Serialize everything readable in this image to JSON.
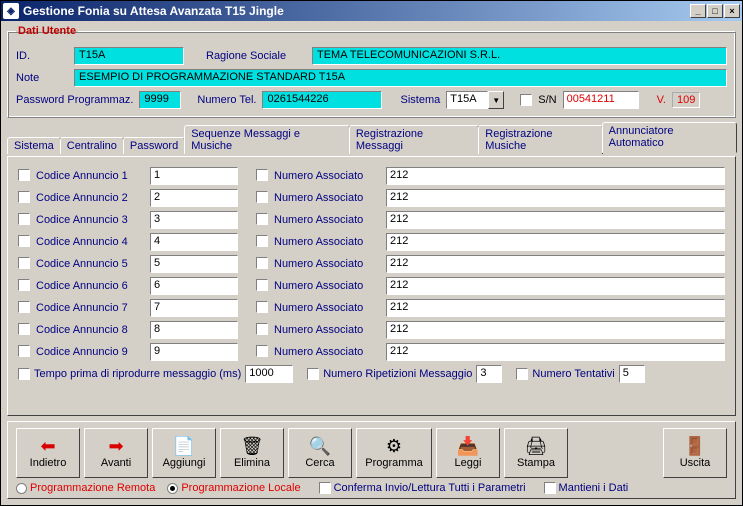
{
  "window": {
    "title": "Gestione Fonia su Attesa Avanzata T15 Jingle"
  },
  "dati": {
    "legend": "Dati Utente",
    "id_label": "ID.",
    "id_value": "T15A",
    "ragione_label": "Ragione Sociale",
    "ragione_value": "TEMA TELECOMUNICAZIONI S.R.L.",
    "note_label": "Note",
    "note_value": "ESEMPIO DI PROGRAMMAZIONE STANDARD T15A",
    "pw_label": "Password Programmaz.",
    "pw_value": "9999",
    "tel_label": "Numero Tel.",
    "tel_value": "0261544226",
    "sistema_label": "Sistema",
    "sistema_value": "T15A",
    "sn_label": "S/N",
    "sn_value": "00541211",
    "v_label": "V.",
    "v_value": "109"
  },
  "tabs": {
    "t1": "Sistema",
    "t2": "Centralino",
    "t3": "Password",
    "t4": "Sequenze Messaggi e Musiche",
    "t5": "Registrazione Messaggi",
    "t6": "Registrazione Musiche",
    "t7": "Annunciatore Automatico"
  },
  "ann": {
    "rows": [
      {
        "label": "Codice Annuncio 1",
        "code": "1",
        "assoc_label": "Numero Associato",
        "num": "212"
      },
      {
        "label": "Codice Annuncio 2",
        "code": "2",
        "assoc_label": "Numero Associato",
        "num": "212"
      },
      {
        "label": "Codice Annuncio 3",
        "code": "3",
        "assoc_label": "Numero Associato",
        "num": "212"
      },
      {
        "label": "Codice Annuncio 4",
        "code": "4",
        "assoc_label": "Numero Associato",
        "num": "212"
      },
      {
        "label": "Codice Annuncio 5",
        "code": "5",
        "assoc_label": "Numero Associato",
        "num": "212"
      },
      {
        "label": "Codice Annuncio 6",
        "code": "6",
        "assoc_label": "Numero Associato",
        "num": "212"
      },
      {
        "label": "Codice Annuncio 7",
        "code": "7",
        "assoc_label": "Numero Associato",
        "num": "212"
      },
      {
        "label": "Codice Annuncio 8",
        "code": "8",
        "assoc_label": "Numero Associato",
        "num": "212"
      },
      {
        "label": "Codice Annuncio 9",
        "code": "9",
        "assoc_label": "Numero Associato",
        "num": "212"
      }
    ],
    "tempo_label": "Tempo prima di riprodurre messaggio (ms)",
    "tempo_value": "1000",
    "rip_label": "Numero Ripetizioni Messaggio",
    "rip_value": "3",
    "tent_label": "Numero Tentativi",
    "tent_value": "5"
  },
  "toolbar": {
    "indietro": "Indietro",
    "avanti": "Avanti",
    "aggiungi": "Aggiungi",
    "elimina": "Elimina",
    "cerca": "Cerca",
    "programma": "Programma",
    "leggi": "Leggi",
    "stampa": "Stampa",
    "uscita": "Uscita"
  },
  "opts": {
    "remota": "Programmazione Remota",
    "locale": "Programmazione Locale",
    "conferma": "Conferma Invio/Lettura Tutti i Parametri",
    "mantieni": "Mantieni i Dati"
  }
}
